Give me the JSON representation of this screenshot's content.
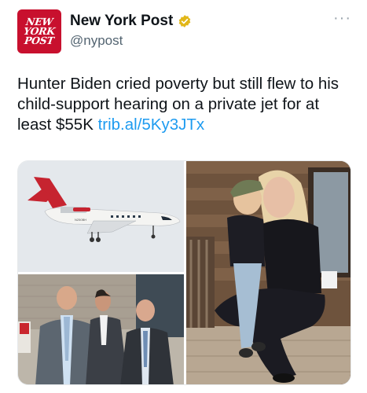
{
  "account": {
    "avatar_lines": [
      "NEW",
      "YORK",
      "POST"
    ],
    "display_name": "New York Post",
    "handle": "@nypost",
    "verified_color": "#e2b719",
    "more_icon": "more-horizontal-icon"
  },
  "tweet": {
    "text": "Hunter Biden cried poverty but still flew to his child-support hearing on a private jet for at least $55K ",
    "link": "trib.al/5Ky3JTx"
  },
  "media": {
    "photos": [
      "private-jet-photo",
      "men-in-suits-photo",
      "woman-and-child-photo"
    ],
    "tail_number": "N250BH"
  },
  "colors": {
    "brand_red": "#c8102e",
    "link_blue": "#1d9bf0",
    "text": "#0f1419",
    "secondary": "#536471"
  }
}
